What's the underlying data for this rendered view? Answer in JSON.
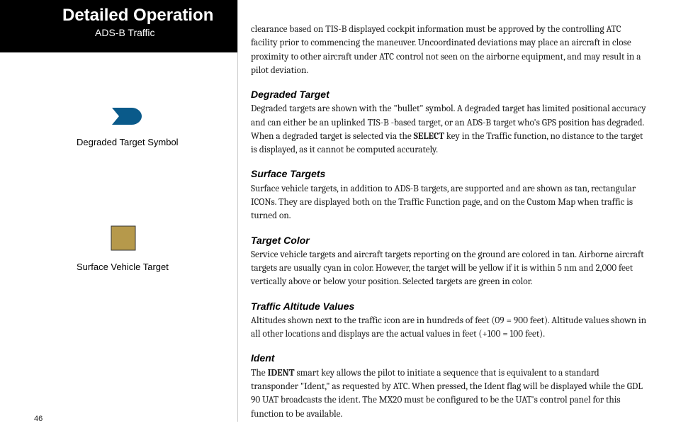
{
  "header": {
    "title": "Detailed Operation",
    "subtitle": "ADS-B Traffic"
  },
  "legend": {
    "degraded": {
      "label": "Degraded Target Symbol"
    },
    "surface": {
      "label": "Surface Vehicle Target"
    }
  },
  "intro_paragraph": "clearance based on TIS-B displayed cockpit information must be approved by the controlling ATC facility prior to commencing the maneuver. Uncoordinated deviations may place an aircraft in close proximity to other aircraft under ATC control not seen on the airborne equipment, and may result in a pilot deviation.",
  "sections": {
    "degraded_target": {
      "heading": "Degraded Target",
      "body_a": "Degraded targets are shown with the \"bullet\" symbol. A degraded target has limited positional accuracy and can either be an uplinked TIS-B -based target, or an ADS-B target who's GPS position has degraded. When a degraded target is selected via the ",
      "body_bold": "SELECT",
      "body_b": " key in the Traffic function, no distance to the target is displayed, as it cannot be computed accurately."
    },
    "surface_targets": {
      "heading": "Surface Targets",
      "body": "Surface vehicle targets, in addition to ADS-B targets, are supported and are shown as tan, rectangular ICONs. They are displayed both on the Traffic Function page, and on the Custom Map when traffic is turned on."
    },
    "target_color": {
      "heading": "Target Color",
      "body": "Service vehicle targets and aircraft targets reporting on the ground are colored in tan. Airborne aircraft targets are usually cyan in color. However, the target will be yellow if it is within 5 nm and 2,000 feet vertically above or below your position. Selected targets are green in color."
    },
    "altitude": {
      "heading": "Traffic Altitude Values",
      "body": "Altitudes shown next to the traffic icon are in hundreds of feet (09 = 900 feet). Altitude values shown in all other locations and displays are the actual values in feet (+100 = 100 feet)."
    },
    "ident": {
      "heading": "Ident",
      "body_a": "The ",
      "body_bold": "IDENT",
      "body_b": " smart key allows the pilot to initiate a sequence that is equivalent to a standard transponder \"Ident,\" as requested by ATC. When pressed, the Ident flag will be displayed while the GDL 90 UAT broadcasts the ident. The MX20 must be configured to be the UAT's control panel for this function to be available."
    }
  },
  "page_number": "46"
}
